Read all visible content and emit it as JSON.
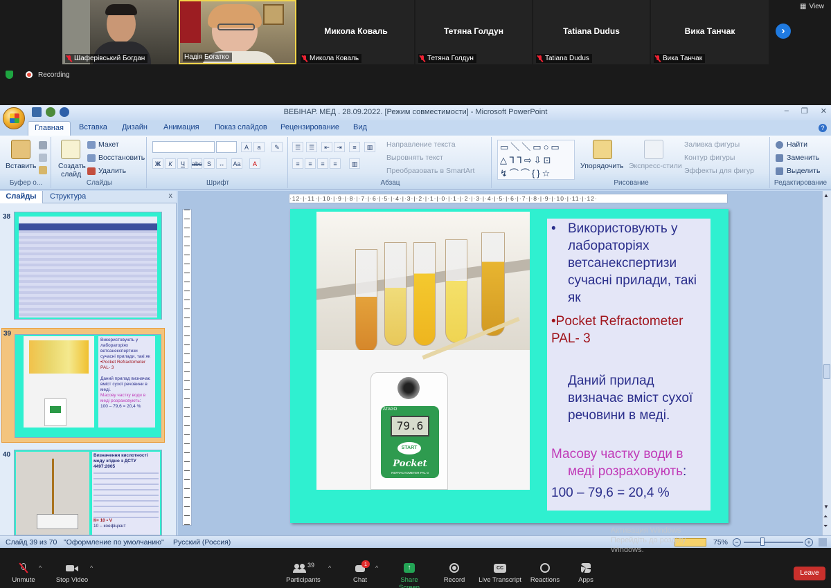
{
  "zoom": {
    "view_label": "View",
    "recording_label": "Recording",
    "participants": [
      {
        "name": "Шаферівський Богдан",
        "video": true
      },
      {
        "name": "Надія Богатко",
        "video": true
      },
      {
        "name": "Микола Коваль",
        "video": false
      },
      {
        "name": "Тетяна Голдун",
        "video": false
      },
      {
        "name": "Tatiana Dudus",
        "video": false
      },
      {
        "name": "Вика Танчак",
        "video": false
      }
    ],
    "toolbar": {
      "unmute": "Unmute",
      "stop_video": "Stop Video",
      "participants": "Participants",
      "participants_count": "39",
      "chat": "Chat",
      "chat_badge": "1",
      "share_screen": "Share Screen",
      "record": "Record",
      "live_transcript": "Live Transcript",
      "reactions": "Reactions",
      "apps": "Apps",
      "leave": "Leave"
    },
    "accent": "#1f7ae0",
    "leave_color": "#c9302c",
    "share_color": "#23a455"
  },
  "ppt": {
    "title": "ВЕБІНАР. МЕД . 28.09.2022. [Режим совместимости] - Microsoft PowerPoint",
    "tabs": [
      "Главная",
      "Вставка",
      "Дизайн",
      "Анимация",
      "Показ слайдов",
      "Рецензирование",
      "Вид"
    ],
    "ribbon": {
      "clipboard": {
        "paste": "Вставить",
        "label": "Буфер о..."
      },
      "slides": {
        "create_1": "Создать",
        "create_2": "слайд",
        "layout": "Макет",
        "reset": "Восстановить",
        "delete": "Удалить",
        "label": "Слайды"
      },
      "font": {
        "label": "Шрифт"
      },
      "paragraph": {
        "text_direction": "Направление текста",
        "align_text": "Выровнять текст",
        "smartart": "Преобразовать в SmartArt",
        "label": "Абзац"
      },
      "drawing": {
        "arrange": "Упорядочить",
        "quick_styles": "Экспресс-стили",
        "fill": "Заливка фигуры",
        "outline": "Контур фигуры",
        "effects": "Эффекты для фигур",
        "label": "Рисование"
      },
      "editing": {
        "find": "Найти",
        "replace": "Заменить",
        "select": "Выделить",
        "label": "Редактирование"
      }
    },
    "panel_tabs": [
      "Слайды",
      "Структура"
    ],
    "thumbnails": [
      {
        "num": "38"
      },
      {
        "num": "39"
      },
      {
        "num": "40",
        "title_1": "Визначення кислотності",
        "title_2": "меду згідно з ДСТУ",
        "title_3": "4497:2005",
        "formula": "К= 10 • V",
        "note": "10 – коефіцієнт"
      }
    ],
    "ruler_marks": "·12·|·11·|·10·|·9·|·8·|·7·|·6·|·5·|·4·|·3·|·2·|·1·|·0·|·1·|·2·|·3·|·4·|·5·|·6·|·7·|·8·|·9·|·10·|·11·|·12·",
    "slide": {
      "bullet_1": "Використовують у лабораторіях ветсанекспертизи сучасні прилади, такі як",
      "device_1": "•Pocket Refractometer",
      "device_2": "PAL- 3",
      "desc": "Даний прилад визначає вміст сухої речовини  в меді.",
      "water_1": "Масову частку води в",
      "water_2": "меді розраховують",
      "water_colon": ":",
      "formula": "100 – 79,6 = 20,4 %",
      "refractometer_reading": "79.6",
      "device_button": "START",
      "device_brand": "Pocket",
      "device_model": "REFRACTOMETER PAL-3",
      "maker": "ATAGO"
    },
    "status": {
      "slide_of": "Слайд 39 из 70",
      "theme": "\"Оформление по умолчанию\"",
      "lang": "Русский (Россия)",
      "zoom": "75%"
    }
  },
  "windows_activation": {
    "line1": "Активация Windows",
    "line2": "Перейдіть до розділу",
    "line3": "Windows."
  }
}
